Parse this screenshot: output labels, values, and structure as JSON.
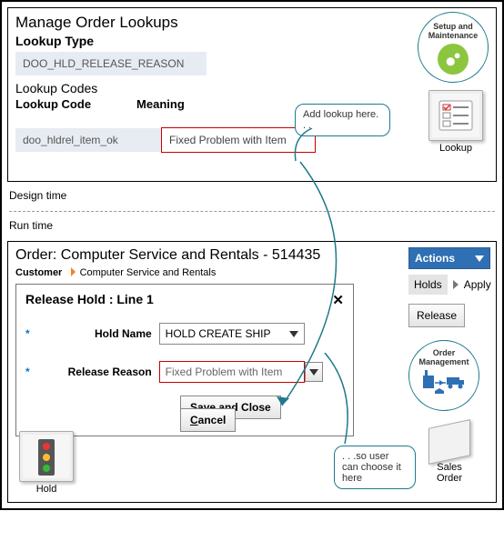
{
  "top": {
    "title": "Manage Order Lookups",
    "lookupTypeLabel": "Lookup Type",
    "lookupTypeValue": "DOO_HLD_RELEASE_REASON",
    "lookupCodesHeader": "Lookup Codes",
    "colCode": "Lookup Code",
    "colMeaning": "Meaning",
    "rowCode": "doo_hldrel_item_ok",
    "rowMeaning": "Fixed Problem with Item",
    "callout": "Add lookup here. . .",
    "setupLabel1": "Setup and",
    "setupLabel2": "Maintenance",
    "lookupTile": "Lookup"
  },
  "mid": {
    "designTime": "Design time",
    "runTime": "Run time"
  },
  "bottom": {
    "orderTitle": "Order: Computer Service and Rentals - 514435",
    "customerLabel": "Customer",
    "customerValue": "Computer Service and Rentals",
    "dialogTitle": "Release Hold : Line 1",
    "close": "✕",
    "holdNameLabel": "Hold Name",
    "holdNameValue": "HOLD CREATE SHIP",
    "releaseReasonLabel": "Release Reason",
    "releaseReasonValue": "Fixed Problem with Item",
    "saveClose": "Save and Close",
    "cancel": "Cancel",
    "holdTile": "Hold",
    "actions": "Actions",
    "holds": "Holds",
    "apply": "Apply",
    "release": "Release",
    "omLabel1": "Order",
    "omLabel2": "Management",
    "soTile1": "Sales",
    "soTile2": "Order",
    "callout": ". . .so user can choose it here"
  }
}
